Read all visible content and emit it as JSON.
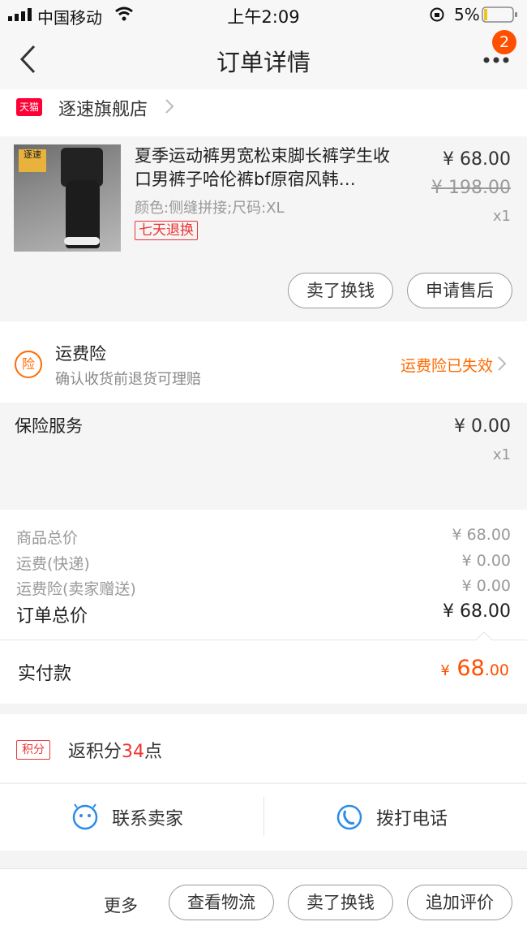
{
  "status_bar": {
    "carrier": "中国移动",
    "time": "上午2:09",
    "battery": "5%"
  },
  "nav": {
    "title": "订单详情",
    "badge": "2"
  },
  "shop": {
    "tag": "天猫",
    "name": "逐速旗舰店"
  },
  "product": {
    "logo": "逐速",
    "title": "夏季运动裤男宽松束脚长裤学生收口男裤子哈伦裤bf原宿风韩…",
    "spec": "颜色:侧缝拼接;尺码:XL",
    "return_tag": "七天退换",
    "price": "¥ 68.00",
    "original_price": "¥ 198.00",
    "quantity": "x1",
    "buttons": [
      "卖了换钱",
      "申请售后"
    ]
  },
  "insurance": {
    "icon": "险",
    "title": "运费险",
    "subtitle": "确认收货前退货可理赔",
    "status": "运费险已失效"
  },
  "service": {
    "title": "保险服务",
    "price": "¥ 0.00",
    "quantity": "x1"
  },
  "summary": {
    "rows": [
      {
        "label": "商品总价",
        "value": "¥ 68.00"
      },
      {
        "label": "运费(快递)",
        "value": "¥ 0.00"
      },
      {
        "label": "运费险(卖家赠送)",
        "value": "¥ 0.00"
      }
    ],
    "total_label": "订单总价",
    "total_value": "¥ 68.00",
    "paid_label": "实付款",
    "paid_currency": "¥",
    "paid_integer": "68",
    "paid_decimal": ".00"
  },
  "points": {
    "tag": "积分",
    "prefix": "返积分",
    "amount": "34",
    "suffix": "点"
  },
  "contact": {
    "seller": "联系卖家",
    "phone": "拨打电话"
  },
  "bottom_bar": {
    "more": "更多",
    "buttons": [
      "查看物流",
      "卖了换钱",
      "追加评价"
    ]
  },
  "colors": {
    "accent": "#ff5000",
    "tmall_red": "#ff0036",
    "link_blue": "#2d8ce6"
  }
}
